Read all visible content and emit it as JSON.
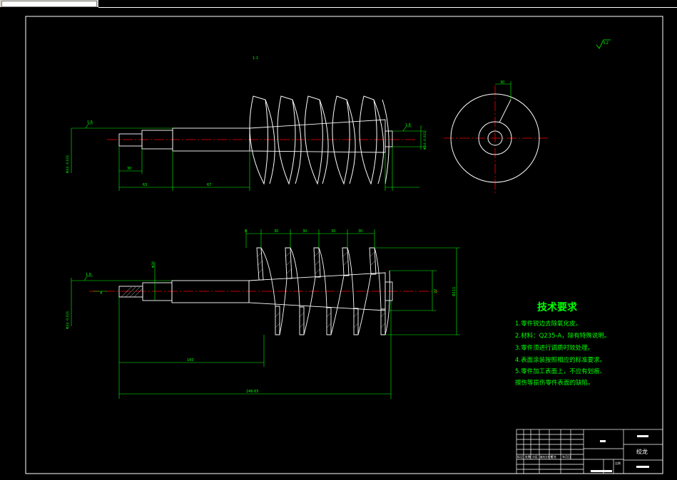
{
  "window": {
    "title_field": ""
  },
  "drawing": {
    "section_label": "1-1",
    "roughness_corner": "3.2",
    "dims_top": {
      "keyway_len": "30",
      "len_a": "63",
      "len_b": "67",
      "dia_right": "Φ24 -0.002",
      "dia_left": "Φ24 -0.021",
      "roughness": "1.6",
      "hub_width": "30"
    },
    "dims_bottom": {
      "pitch_labels": [
        "8",
        "30",
        "30",
        "30",
        "30"
      ],
      "len_total_1": "160",
      "len_total_2": "246.65",
      "dia_big": "Φ111",
      "dia_small": "22",
      "dia_left": "Φ24 -0.021",
      "roughness": "1.6",
      "mark_left": "4",
      "keyway_mark": "Φ30"
    },
    "requirements": {
      "title": "技术要求",
      "items": [
        "1.零件锐边去除氧化皮。",
        "2.材料：Q235-A，除有特殊说明。",
        "3.零件须进行调质时效处理。",
        "4.表面涂装按照相应的标准要求。",
        "5.零件加工表面上，不应有划痕、",
        "擦伤等损伤零件表面的缺陷。"
      ]
    },
    "title_block": {
      "part_name": "绞龙",
      "header_cells": [
        "标记",
        "处数",
        "分区",
        "更改文件号",
        "签名",
        "年月日"
      ],
      "small_label": "比例"
    }
  }
}
